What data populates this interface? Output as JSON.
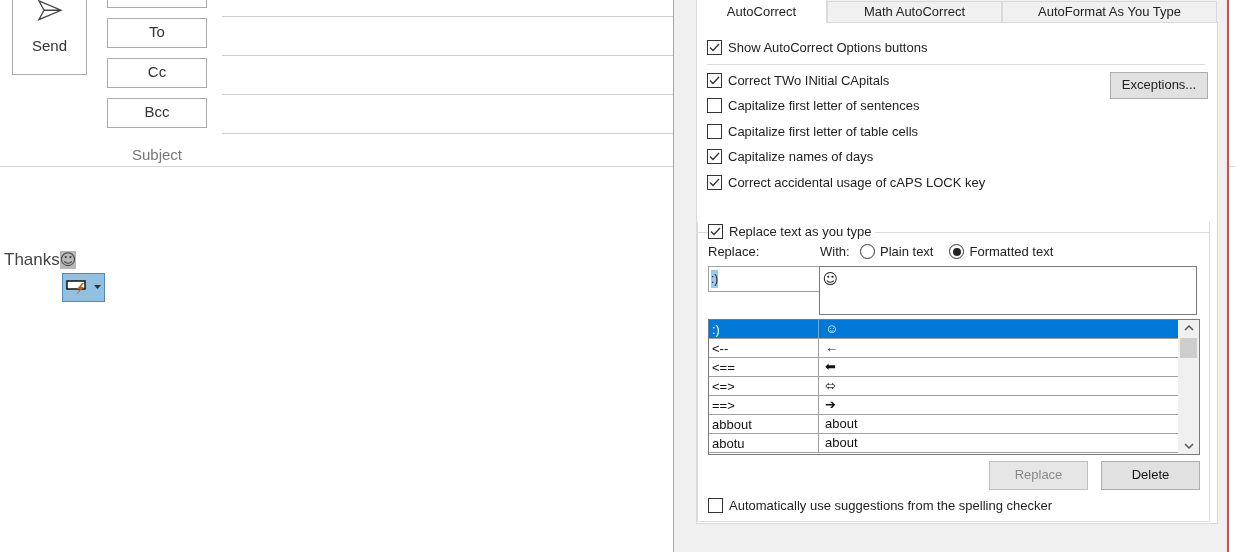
{
  "compose": {
    "send_button": "Send",
    "address_buttons": [
      "To",
      "Cc",
      "Bcc"
    ],
    "subject_label": "Subject",
    "body_text": "Thanks",
    "body_emoji": "☺"
  },
  "dialog": {
    "tabs": [
      {
        "label": "AutoCorrect",
        "selected": true
      },
      {
        "label": "Math AutoCorrect",
        "selected": false
      },
      {
        "label": "AutoFormat As You Type",
        "selected": false
      }
    ],
    "show_options": {
      "label": "Show AutoCorrect Options buttons",
      "checked": true
    },
    "options": [
      {
        "label": "Correct TWo INitial CApitals",
        "checked": true
      },
      {
        "label": "Capitalize first letter of sentences",
        "checked": false
      },
      {
        "label": "Capitalize first letter of table cells",
        "checked": false
      },
      {
        "label": "Capitalize names of days",
        "checked": true
      },
      {
        "label": "Correct accidental usage of cAPS LOCK key",
        "checked": true
      }
    ],
    "exceptions_button": "Exceptions...",
    "replace_as_you_type": {
      "label": "Replace text as you type",
      "checked": true
    },
    "replace_label": "Replace:",
    "with_label": "With:",
    "format_options": [
      {
        "label": "Plain text",
        "selected": false
      },
      {
        "label": "Formatted text",
        "selected": true
      }
    ],
    "replace_value": ":)",
    "with_value": "☺",
    "entries": [
      {
        "replace": ":)",
        "with": "☺",
        "selected": true
      },
      {
        "replace": "<--",
        "with": "←",
        "selected": false
      },
      {
        "replace": "<==",
        "with": "⬅",
        "selected": false
      },
      {
        "replace": "<=>",
        "with": "⬄",
        "selected": false
      },
      {
        "replace": "==>",
        "with": "➔",
        "selected": false
      },
      {
        "replace": "abbout",
        "with": "about",
        "selected": false
      },
      {
        "replace": "abotu",
        "with": "about",
        "selected": false
      }
    ],
    "buttons": [
      {
        "label": "Replace",
        "disabled": true
      },
      {
        "label": "Delete",
        "disabled": false
      }
    ],
    "spelling_option": {
      "label": "Automatically use suggestions from the spelling checker",
      "checked": false
    }
  }
}
